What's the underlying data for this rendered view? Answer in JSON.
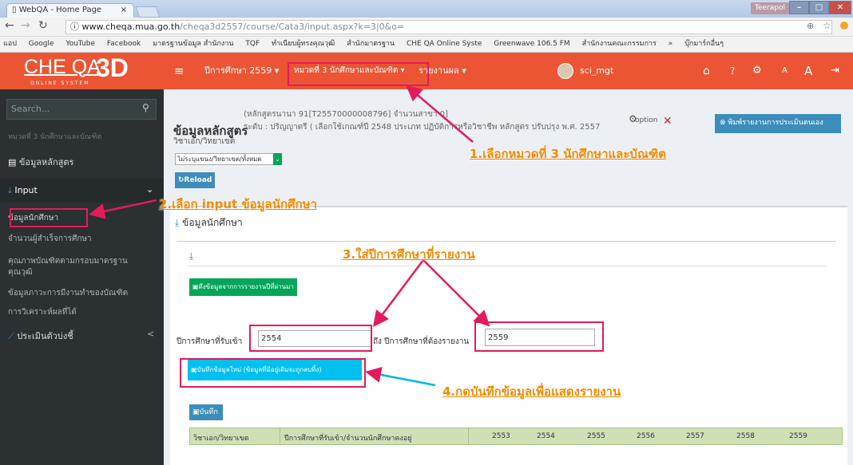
{
  "browser": {
    "tab_title": "WebQA - Home Page",
    "tab_close": "×",
    "user_badge": "Teerapol",
    "url_host": "www.cheqa.mua.go.th",
    "url_path": "/cheqa3d2557/course/Cata3/input.aspx?k=3|0&o=",
    "bookmarks": [
      "แอป",
      "Google",
      "YouTube",
      "Facebook",
      "มาตรฐานข้อมูล สำนักงาน",
      "TQF",
      "ทำเนียบผู้ทรงคุณวุฒิ",
      "สำนักมาตรฐาน",
      "CHE QA Online Syste",
      "Greenwave 106.5 FM",
      "สำนักงานคณะกรรมการ",
      "»",
      "บุ๊กมาร์กอื่นๆ"
    ]
  },
  "navbar": {
    "logo_main": "CHE QA",
    "logo_3d": "3D",
    "logo_sub": "ONLINE SYSTEM",
    "menu_year": "ปีการศึกษา 2559 ▾",
    "menu_category": "หมวดที่ 3 นักศึกษาและบัณฑิต ▾",
    "menu_report": "รายงานผล ▾",
    "username": "sci_mgt"
  },
  "sidebar": {
    "search_placeholder": "Search...",
    "section_label": "หมวดที่ 3 นักศึกษาและบัณฑิต",
    "course_data": "ข้อมูลหลักสูตร",
    "input_label": "Input",
    "input_items": [
      "ข้อมูลนักศึกษา",
      "จำนวนผู้สำเร็จการศึกษา",
      "คุณภาพบัณฑิตตามกรอบมาตรฐาน",
      "คุณวุฒิ",
      "ข้อมูลภาวะการมีงานทำของบัณฑิต",
      "การวิเคราะห์ผลที่ได้"
    ],
    "evaluate_label": "ประเมินตัวบ่งชี้",
    "evaluate_chevron": "<"
  },
  "main": {
    "title": "ข้อมูลหลักสูตร",
    "course_line1": "(หลักสูตรนานา 91[T25570000008796] จำนวนสาขา 0]",
    "course_line2": "ระดับ : ปริญญาตรี ( เลือกใช้เกณฑ์ปี 2548 ประเภท ปฏิบัติการหรือวิชาชีพ หลักสูตร ปรับปรุง พ.ศ. 2557",
    "option_label": "option",
    "print_button": "พิมพ์รายงานการประเมินตนเอง",
    "major_label": "วิชาเอก/วิทยาเขต",
    "select_value": "ไม่ระบุแขนง/วิทยาเขต/ทั้งหมด",
    "reload_button": "Reload",
    "panel_title": "ข้อมูลนักศึกษา",
    "pull_button": "ดึงข้อมูลจากการรายงานปีที่ผ่านมา",
    "year_from_label": "ปีการศึกษาที่รับเข้า",
    "year_from_value": "2554",
    "year_to_label": "ถึง ปีการศึกษาที่ต้องรายงาน",
    "year_to_value": "2559",
    "save_new_button": "บันทึกข้อมูลใหม่ (ข้อมูลที่มีอยู่เดิมจะถูกลบทิ้ง)",
    "save_button": "บันทึก",
    "table_headers": [
      "วิชาเอก/วิทยาเขต",
      "ปีการศึกษาที่รับเข้า/จำนวนนักศึกษาคงอยู่",
      "2553",
      "2554",
      "2555",
      "2556",
      "2557",
      "2558",
      "2559"
    ]
  },
  "annotations": {
    "step1": "1.เลือกหมวดที่ 3 นักศึกษาและบัณฑิต",
    "step2": "2.เลือก input ข้อมูลนักศึกษา",
    "step3": "3.ใส่ปีการศึกษาที่รายงาน",
    "step4": "4.กดบันทึกข้อมูลเพื่อแสดงรายงาน"
  },
  "colors": {
    "navbar": "#eb5533",
    "sidebar": "#2b3032",
    "annotation": "#f28a00",
    "highlight": "#e31b5a",
    "green": "#00a65a",
    "blue": "#3c8dbc"
  }
}
